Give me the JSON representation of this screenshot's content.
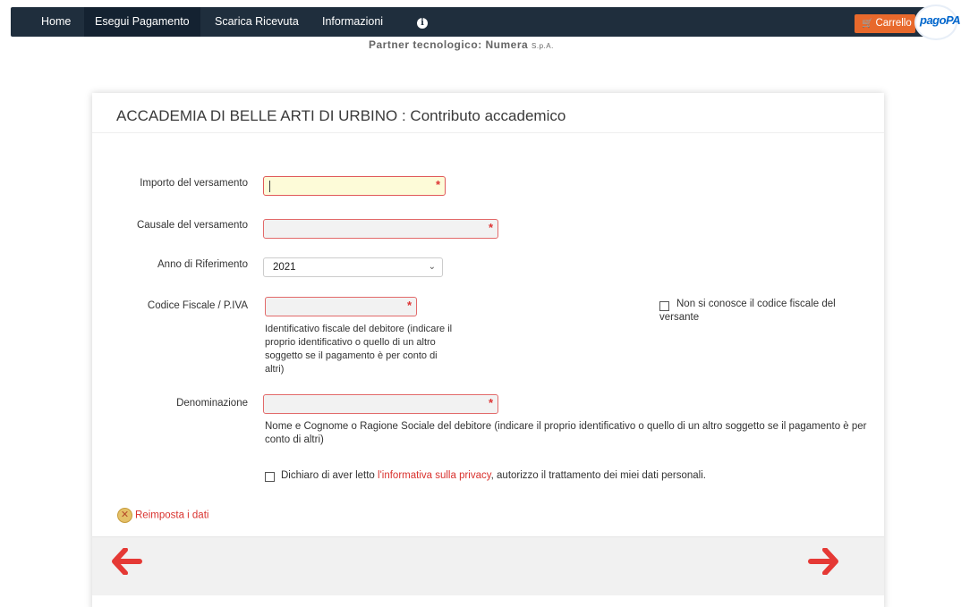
{
  "nav": {
    "home": "Home",
    "pay": "Esegui Pagamento",
    "receipt": "Scarica Ricevuta",
    "info": "Informazioni",
    "info_icon": "info-circle-icon",
    "cart_label": "Carrello",
    "logo_text": "pagoPA"
  },
  "partner": {
    "text": "Partner tecnologico: Numera",
    "suffix": "S.p.A."
  },
  "card": {
    "title": "ACCADEMIA DI BELLE ARTI DI URBINO : Contributo accademico"
  },
  "form": {
    "importo_label": "Importo del versamento",
    "causale_label": "Causale del versamento",
    "anno_label": "Anno di Riferimento",
    "anno_value": "2021",
    "cf_label": "Codice Fiscale / P.IVA",
    "cf_help": "Identificativo fiscale del debitore (indicare il proprio identificativo o quello di un altro soggetto se il pagamento è per conto di altri)",
    "no_cf_label": "Non si conosce il codice fiscale del versante",
    "denominazione_label": "Denominazione",
    "denominazione_help": "Nome e Cognome o Ragione Sociale del debitore (indicare il proprio identificativo o quello di un altro soggetto se il pagamento è per conto di altri)",
    "required_marker": "*",
    "privacy_prefix": "Dichiaro di aver letto ",
    "privacy_link": "l'informativa sulla privacy",
    "privacy_suffix": ", autorizzo il trattamento dei miei dati personali."
  },
  "actions": {
    "reset_label": "Reimposta i dati",
    "back_arrow": "🡐",
    "next_arrow": "🡒"
  },
  "colors": {
    "nav_bg": "#1f2e3d",
    "accent": "#e53935",
    "cart": "#e8692c"
  }
}
